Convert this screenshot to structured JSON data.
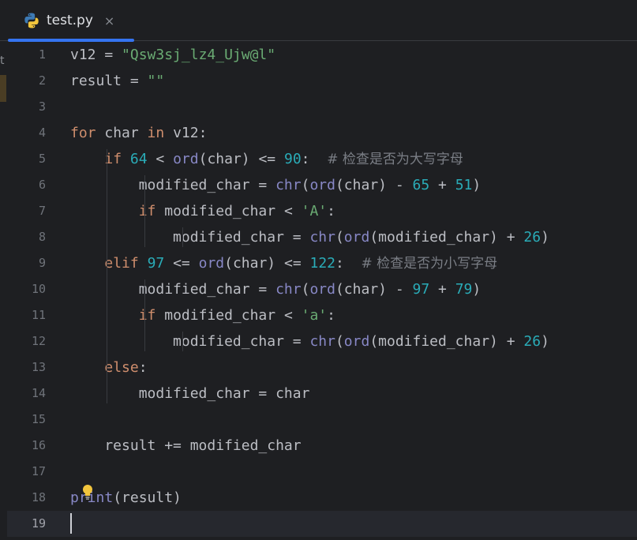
{
  "tab": {
    "title": "test.py",
    "close_glyph": "×",
    "icon": "python-icon"
  },
  "side_fragment": "t",
  "editor": {
    "current_line": 19,
    "lines": [
      {
        "n": "1",
        "tokens": [
          [
            "p",
            "v12 = "
          ],
          [
            "s",
            "\"Qsw3sj_lz4_Ujw@l\""
          ]
        ]
      },
      {
        "n": "2",
        "tokens": [
          [
            "p",
            "result = "
          ],
          [
            "s",
            "\"\""
          ]
        ]
      },
      {
        "n": "3",
        "tokens": []
      },
      {
        "n": "4",
        "tokens": [
          [
            "k",
            "for"
          ],
          [
            "p",
            " char "
          ],
          [
            "k",
            "in"
          ],
          [
            "p",
            " v12:"
          ]
        ]
      },
      {
        "n": "5",
        "tokens": [
          [
            "p",
            "    "
          ],
          [
            "k",
            "if"
          ],
          [
            "p",
            " "
          ],
          [
            "n",
            "64"
          ],
          [
            "p",
            " < "
          ],
          [
            "b",
            "ord"
          ],
          [
            "p",
            "(char) <= "
          ],
          [
            "n",
            "90"
          ],
          [
            "p",
            ":  "
          ],
          [
            "c",
            "# 检查是否为大写字母"
          ]
        ]
      },
      {
        "n": "6",
        "tokens": [
          [
            "p",
            "        modified_char = "
          ],
          [
            "b",
            "chr"
          ],
          [
            "p",
            "("
          ],
          [
            "b",
            "ord"
          ],
          [
            "p",
            "(char) - "
          ],
          [
            "n",
            "65"
          ],
          [
            "p",
            " + "
          ],
          [
            "n",
            "51"
          ],
          [
            "p",
            ")"
          ]
        ]
      },
      {
        "n": "7",
        "tokens": [
          [
            "p",
            "        "
          ],
          [
            "k",
            "if"
          ],
          [
            "p",
            " modified_char < "
          ],
          [
            "s",
            "'A'"
          ],
          [
            "p",
            ":"
          ]
        ]
      },
      {
        "n": "8",
        "tokens": [
          [
            "p",
            "            modified_char = "
          ],
          [
            "b",
            "chr"
          ],
          [
            "p",
            "("
          ],
          [
            "b",
            "ord"
          ],
          [
            "p",
            "(modified_char) + "
          ],
          [
            "n",
            "26"
          ],
          [
            "p",
            ")"
          ]
        ]
      },
      {
        "n": "9",
        "tokens": [
          [
            "p",
            "    "
          ],
          [
            "k",
            "elif"
          ],
          [
            "p",
            " "
          ],
          [
            "n",
            "97"
          ],
          [
            "p",
            " <= "
          ],
          [
            "b",
            "ord"
          ],
          [
            "p",
            "(char) <= "
          ],
          [
            "n",
            "122"
          ],
          [
            "p",
            ":  "
          ],
          [
            "c",
            "# 检查是否为小写字母"
          ]
        ]
      },
      {
        "n": "10",
        "tokens": [
          [
            "p",
            "        modified_char = "
          ],
          [
            "b",
            "chr"
          ],
          [
            "p",
            "("
          ],
          [
            "b",
            "ord"
          ],
          [
            "p",
            "(char) - "
          ],
          [
            "n",
            "97"
          ],
          [
            "p",
            " + "
          ],
          [
            "n",
            "79"
          ],
          [
            "p",
            ")"
          ]
        ]
      },
      {
        "n": "11",
        "tokens": [
          [
            "p",
            "        "
          ],
          [
            "k",
            "if"
          ],
          [
            "p",
            " modified_char < "
          ],
          [
            "s",
            "'a'"
          ],
          [
            "p",
            ":"
          ]
        ]
      },
      {
        "n": "12",
        "tokens": [
          [
            "p",
            "            modified_char = "
          ],
          [
            "b",
            "chr"
          ],
          [
            "p",
            "("
          ],
          [
            "b",
            "ord"
          ],
          [
            "p",
            "(modified_char) + "
          ],
          [
            "n",
            "26"
          ],
          [
            "p",
            ")"
          ]
        ]
      },
      {
        "n": "13",
        "tokens": [
          [
            "p",
            "    "
          ],
          [
            "k",
            "else"
          ],
          [
            "p",
            ":"
          ]
        ]
      },
      {
        "n": "14",
        "tokens": [
          [
            "p",
            "        modified_char = char"
          ]
        ]
      },
      {
        "n": "15",
        "tokens": []
      },
      {
        "n": "16",
        "tokens": [
          [
            "p",
            "    result += modified_char"
          ]
        ]
      },
      {
        "n": "17",
        "tokens": []
      },
      {
        "n": "18",
        "tokens": [
          [
            "b",
            "print"
          ],
          [
            "p",
            "(result)"
          ]
        ]
      },
      {
        "n": "19",
        "tokens": []
      }
    ]
  },
  "colors": {
    "background": "#1e1f22",
    "keyword": "#cf8e6d",
    "string": "#6aab73",
    "number": "#2aacb8",
    "builtin": "#8888c6",
    "comment": "#7a7e85",
    "accent": "#3574f0"
  }
}
